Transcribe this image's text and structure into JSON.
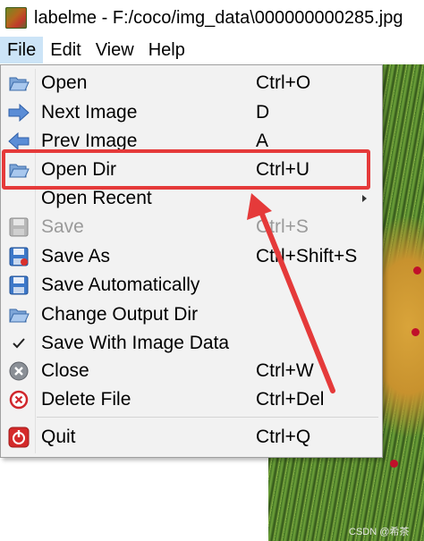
{
  "window": {
    "title": "labelme - F:/coco/img_data\\000000000285.jpg"
  },
  "menubar": {
    "items": [
      {
        "label": "File"
      },
      {
        "label": "Edit"
      },
      {
        "label": "View"
      },
      {
        "label": "Help"
      }
    ]
  },
  "file_menu": {
    "items": [
      {
        "label": "Open",
        "shortcut": "Ctrl+O",
        "icon": "folder-open-icon",
        "enabled": true
      },
      {
        "label": "Next Image",
        "shortcut": "D",
        "icon": "arrow-right-icon",
        "enabled": true
      },
      {
        "label": "Prev Image",
        "shortcut": "A",
        "icon": "arrow-left-icon",
        "enabled": true
      },
      {
        "label": "Open Dir",
        "shortcut": "Ctrl+U",
        "icon": "folder-open-icon",
        "enabled": true
      },
      {
        "label": "Open Recent",
        "shortcut": "",
        "icon": "",
        "enabled": true,
        "submenu": true
      },
      {
        "label": "Save",
        "shortcut": "Ctrl+S",
        "icon": "save-icon",
        "enabled": false
      },
      {
        "label": "Save As",
        "shortcut": "Ctrl+Shift+S",
        "icon": "save-as-icon",
        "enabled": true
      },
      {
        "label": "Save Automatically",
        "shortcut": "",
        "icon": "save-icon",
        "enabled": true
      },
      {
        "label": "Change Output Dir",
        "shortcut": "",
        "icon": "folder-open-icon",
        "enabled": true
      },
      {
        "label": "Save With Image Data",
        "shortcut": "",
        "icon": "checkmark-icon",
        "enabled": true,
        "checked": true
      },
      {
        "label": "Close",
        "shortcut": "Ctrl+W",
        "icon": "close-circle-icon",
        "enabled": true
      },
      {
        "label": "Delete File",
        "shortcut": "Ctrl+Del",
        "icon": "delete-icon",
        "enabled": true
      },
      {
        "label": "Quit",
        "shortcut": "Ctrl+Q",
        "icon": "quit-icon",
        "enabled": true
      }
    ]
  },
  "annotation": {
    "highlight_color": "#e53a3a",
    "highlighted_item": "Open Dir"
  },
  "watermark": {
    "text": "CSDN @希茶"
  },
  "colors": {
    "menu_bg": "#f2f2f2",
    "menubar_active": "#cce4f7",
    "disabled_text": "#9a9a9a"
  }
}
